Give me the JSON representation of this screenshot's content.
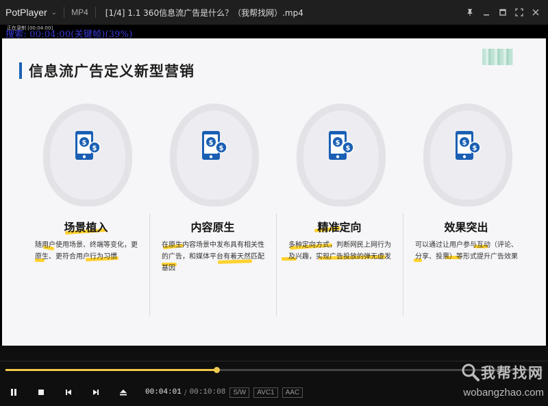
{
  "titlebar": {
    "app_name": "PotPlayer",
    "app_menu_icon": "chevron-down-icon",
    "format": "MP4",
    "file_title": "[1/4] 1.1 360信息流广告是什么？（我帮找网）.mp4",
    "controls": [
      "pin-icon",
      "minimize-icon",
      "maximize-icon",
      "fullscreen-icon",
      "close-icon"
    ]
  },
  "osd": {
    "recording": "正在录制 [00:04:00]",
    "search_text": "搜索: 00:04:00(关键帧)(39%)"
  },
  "slide": {
    "title": "信息流广告定义新型营销",
    "cards": [
      {
        "heading": "场景植入",
        "body": "随用户使用场景、终端等变化，更原生、更符合用户行为习惯"
      },
      {
        "heading": "内容原生",
        "body": "在原生内容场景中发布具有相关性的广告，和媒体平台有着天然匹配基因"
      },
      {
        "heading": "精准定向",
        "body": "多种定向方式，判断网民上网行为及兴趣，实现广告投放的弹无虚发"
      },
      {
        "heading": "效果突出",
        "body": "可以通过让用户参与互动（评论、分享、投票）等形式提升广告效果"
      }
    ],
    "icon": "mobile-payment-icon",
    "accent_color": "#1a5fb4",
    "highlight_color": "#ffd22e"
  },
  "player": {
    "progress": 0.3924,
    "current_time": "00:04:01",
    "time_separator": "/",
    "total_time": "00:10:08",
    "tags": [
      "S/W",
      "AVC1",
      "AAC"
    ],
    "buttons": [
      "pause-icon",
      "stop-icon",
      "previous-icon",
      "next-icon",
      "eject-icon"
    ],
    "progress_color": "#f2c94c"
  },
  "watermark": {
    "text": "我帮找网",
    "url": "wobangzhao.com"
  }
}
